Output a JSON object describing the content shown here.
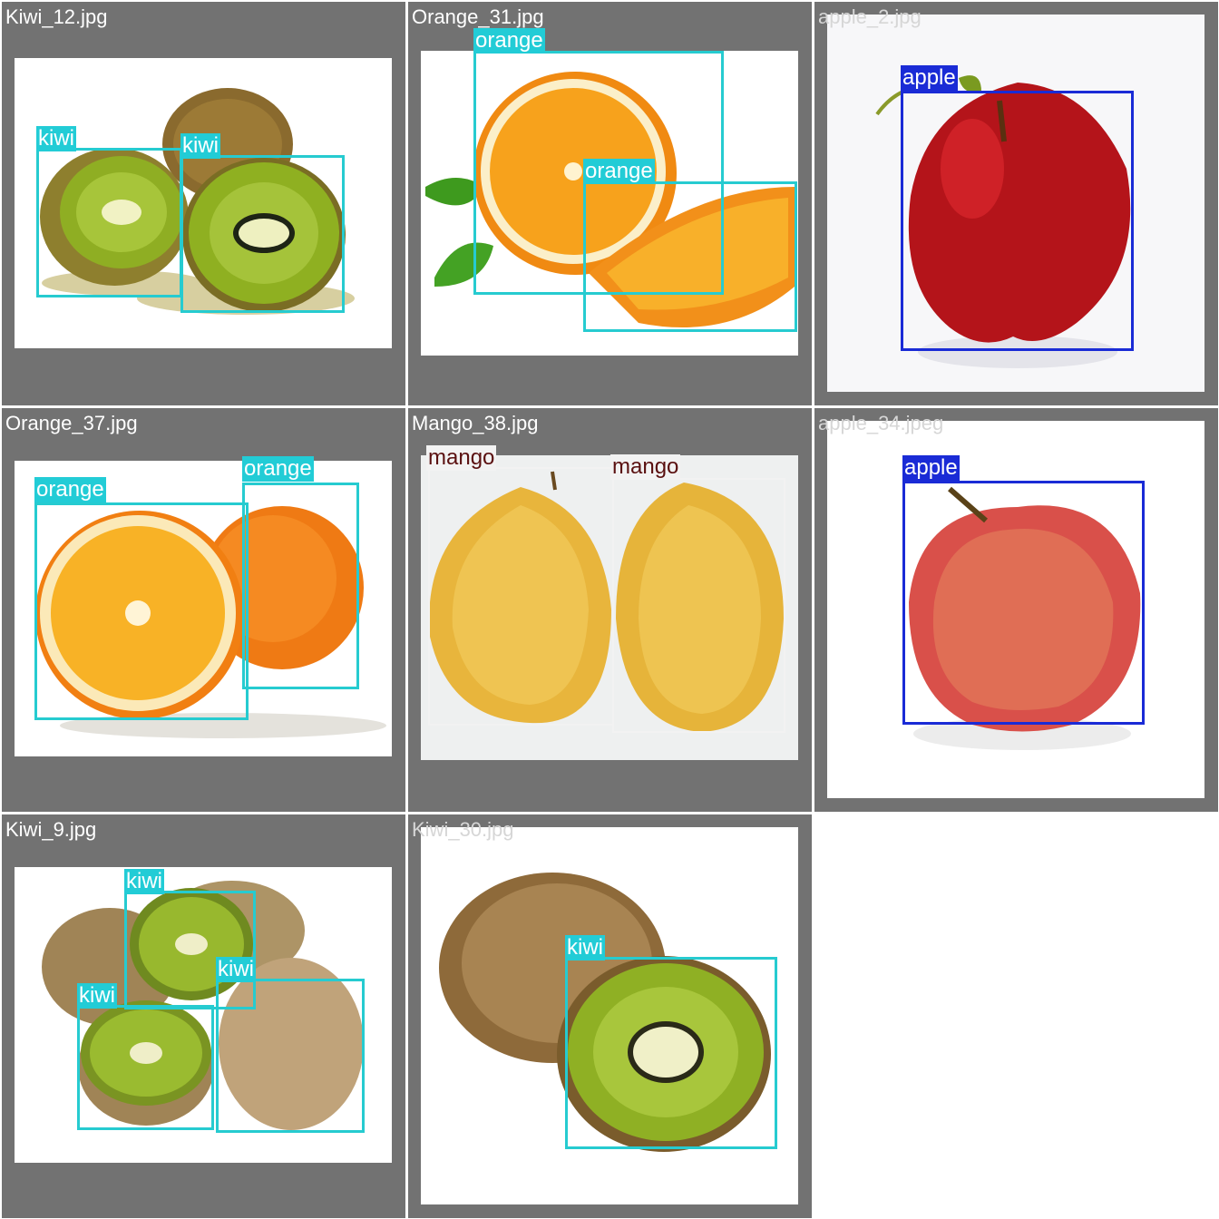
{
  "tiles": [
    {
      "filename": "Kiwi_12.jpg",
      "detections": [
        {
          "label": "kiwi"
        },
        {
          "label": "kiwi"
        }
      ]
    },
    {
      "filename": "Orange_31.jpg",
      "detections": [
        {
          "label": "orange"
        },
        {
          "label": "orange"
        }
      ]
    },
    {
      "filename": "apple_2.jpg",
      "detections": [
        {
          "label": "apple"
        }
      ]
    },
    {
      "filename": "Orange_37.jpg",
      "detections": [
        {
          "label": "orange"
        },
        {
          "label": "orange"
        }
      ]
    },
    {
      "filename": "Mango_38.jpg",
      "detections": [
        {
          "label": "mango"
        },
        {
          "label": "mango"
        }
      ]
    },
    {
      "filename": "apple_34.jpeg",
      "detections": [
        {
          "label": "apple"
        }
      ]
    },
    {
      "filename": "Kiwi_9.jpg",
      "detections": [
        {
          "label": "kiwi"
        },
        {
          "label": "kiwi"
        },
        {
          "label": "kiwi"
        }
      ]
    },
    {
      "filename": "Kiwi_30.jpg",
      "detections": [
        {
          "label": "kiwi"
        }
      ]
    }
  ],
  "colors": {
    "background": "#727272",
    "kiwi": "#26cbd0",
    "orange": "#26cbd0",
    "apple": "#1a2bd6",
    "mango": "#f2f2f2",
    "mango_text": "#5a1010"
  }
}
